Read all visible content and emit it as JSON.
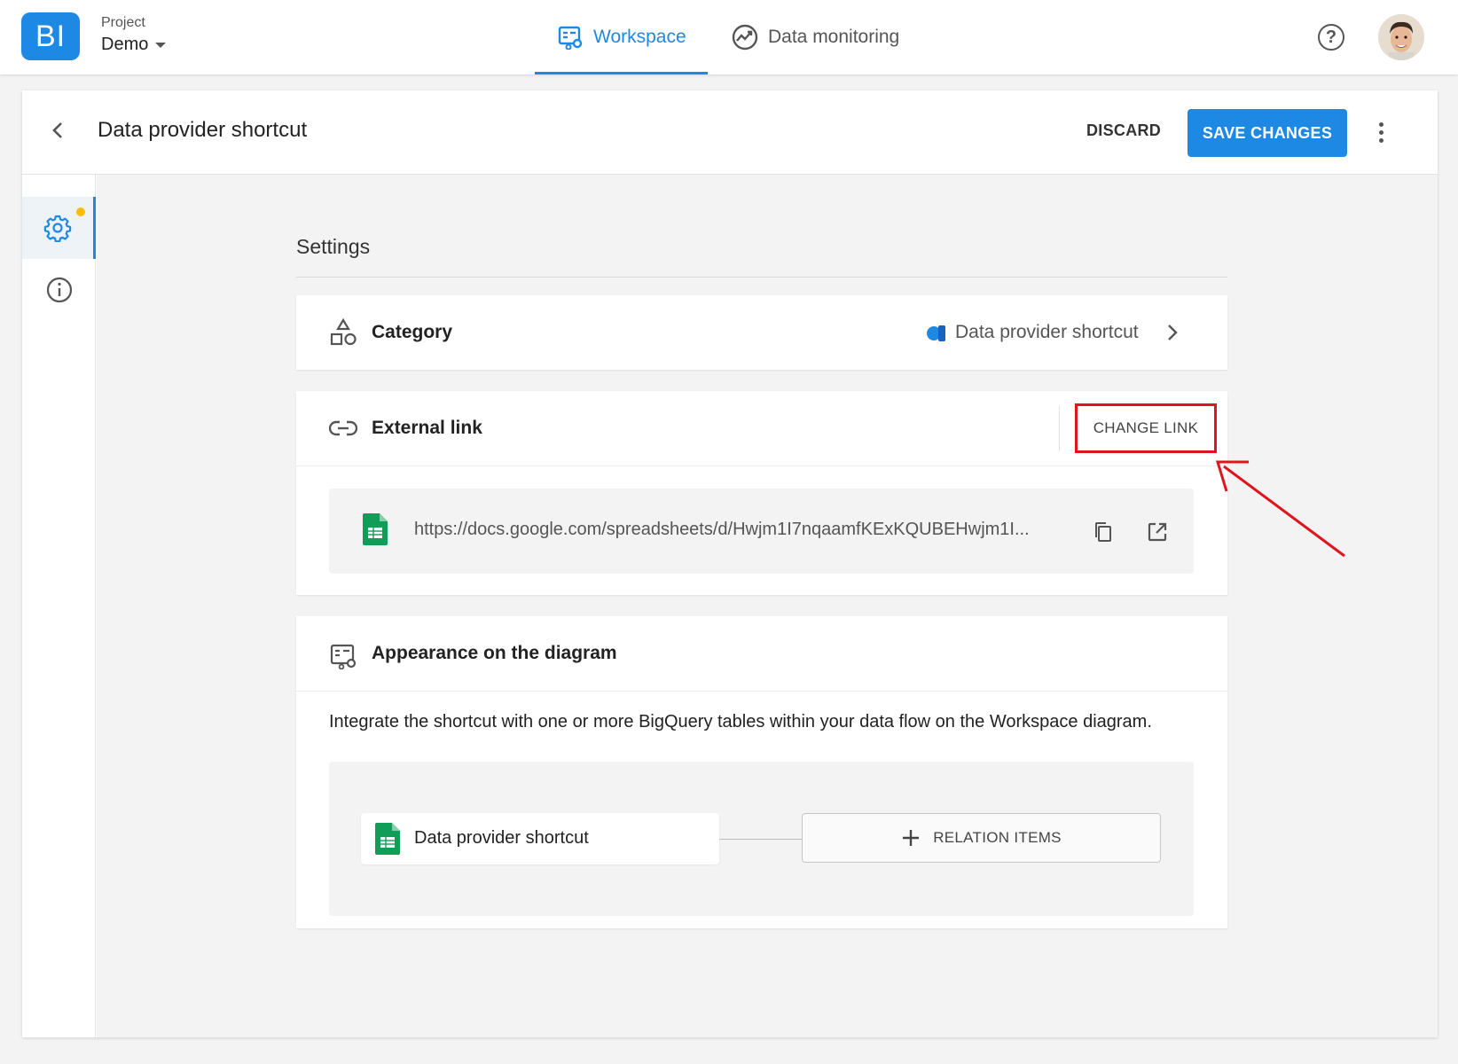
{
  "topbar": {
    "logo_text": "BI",
    "project_label": "Project",
    "project_name": "Demo",
    "tabs": [
      {
        "label": "Workspace",
        "active": true,
        "icon": "workspace-diagram-icon"
      },
      {
        "label": "Data monitoring",
        "active": false,
        "icon": "monitoring-chart-icon"
      }
    ],
    "help_icon": "help-circle-icon",
    "avatar": "user-avatar"
  },
  "header": {
    "title": "Data provider shortcut",
    "discard_label": "DISCARD",
    "save_label": "SAVE CHANGES"
  },
  "siderail": {
    "items": [
      {
        "icon": "gear-icon",
        "active": true,
        "has_notification_dot": true
      },
      {
        "icon": "info-icon",
        "active": false
      }
    ]
  },
  "settings": {
    "title": "Settings",
    "category": {
      "label": "Category",
      "value": "Data provider shortcut"
    },
    "external_link": {
      "label": "External link",
      "change_label": "CHANGE LINK",
      "url": "https://docs.google.com/spreadsheets/d/Hwjm1I7nqaamfKExKQUBEHwjm1I..."
    },
    "appearance": {
      "label": "Appearance on the diagram",
      "description": "Integrate the shortcut with one or more BigQuery tables within your data flow on the Workspace diagram.",
      "node_label": "Data provider shortcut",
      "relation_label": "RELATION ITEMS"
    }
  },
  "colors": {
    "accent": "#1e88e5",
    "highlight": "#e0141c",
    "sheets_green": "#0f9d58",
    "notification": "#fbbc04"
  }
}
